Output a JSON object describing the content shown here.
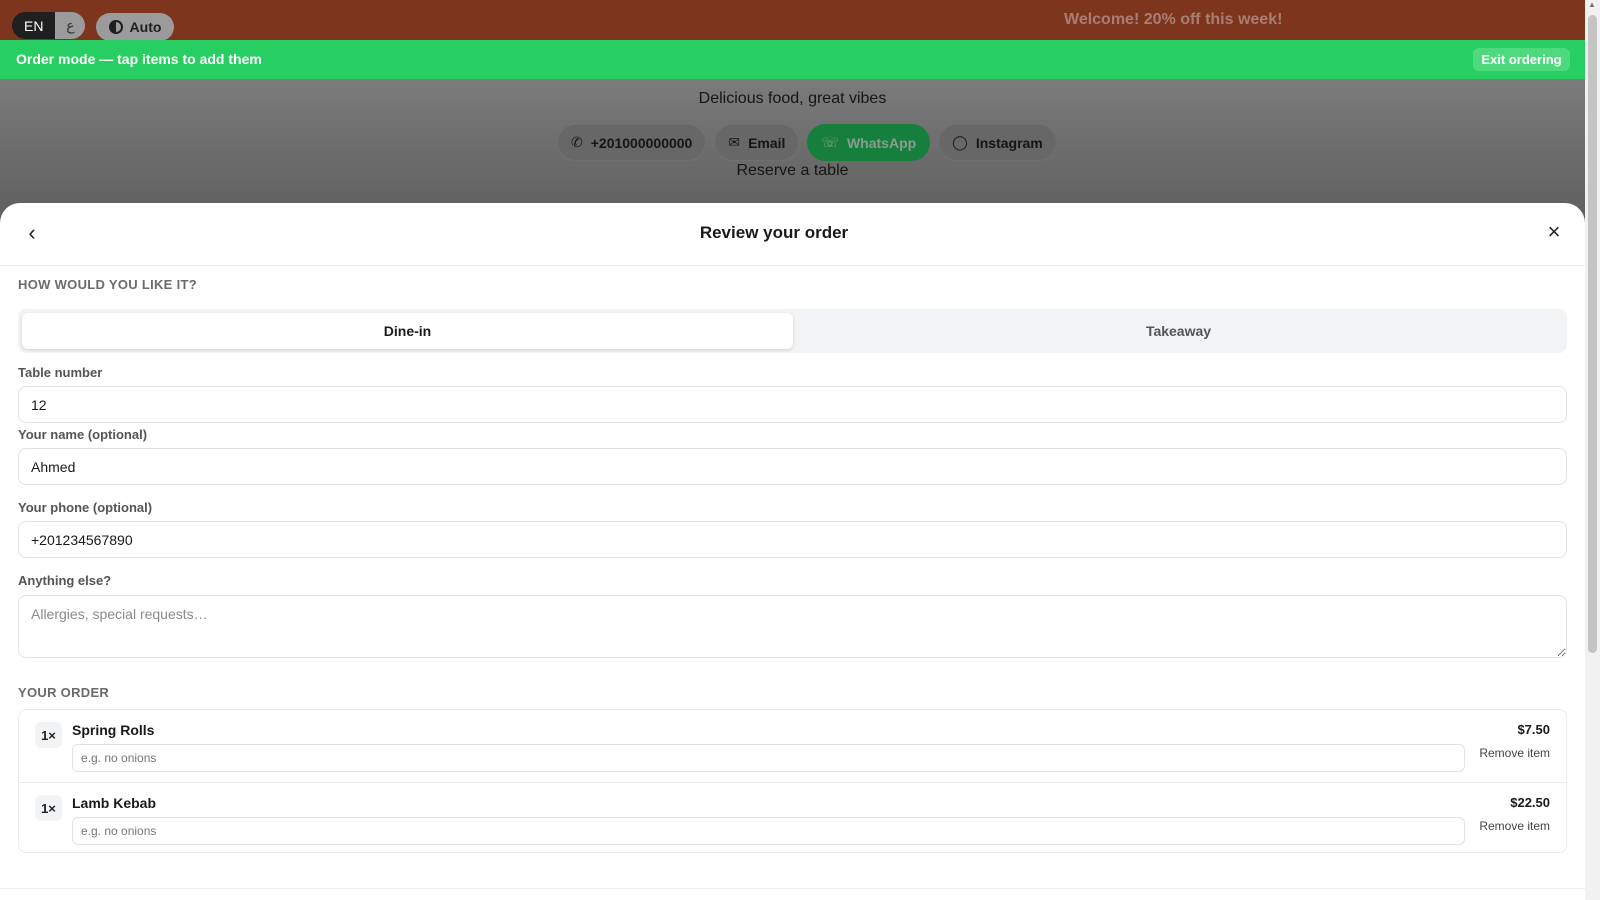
{
  "topbar": {
    "lang_active": "EN",
    "lang_other": "ع",
    "theme_label": "Auto",
    "promo": "Welcome! 20% off this week!"
  },
  "orderbar": {
    "text": "Order mode — tap items to add them",
    "exit_label": "Exit ordering"
  },
  "hero": {
    "tagline": "Delicious food, great vibes",
    "contacts": [
      {
        "icon": "phone-icon",
        "label": "+201000000000"
      },
      {
        "icon": "email-icon",
        "label": "Email"
      },
      {
        "icon": "whatsapp-icon",
        "label": "WhatsApp"
      },
      {
        "icon": "instagram-icon",
        "label": "Instagram"
      }
    ],
    "reserve": "Reserve a table"
  },
  "sheet": {
    "title": "Review your order",
    "mode_section": "HOW WOULD YOU LIKE IT?",
    "modes": [
      {
        "label": "Dine-in",
        "selected": true
      },
      {
        "label": "Takeaway",
        "selected": false
      }
    ],
    "fields": {
      "table": {
        "label": "Table number",
        "value": "12"
      },
      "name": {
        "label": "Your name (optional)",
        "value": "Ahmed"
      },
      "phone": {
        "label": "Your phone (optional)",
        "value": "+201234567890"
      },
      "notes": {
        "label": "Anything else?",
        "placeholder": "Allergies, special requests…"
      }
    },
    "order_section": "YOUR ORDER",
    "items": [
      {
        "qty": "1×",
        "name": "Spring Rolls",
        "price": "$7.50",
        "note_placeholder": "e.g. no onions",
        "remove": "Remove item"
      },
      {
        "qty": "1×",
        "name": "Lamb Kebab",
        "price": "$22.50",
        "note_placeholder": "e.g. no onions",
        "remove": "Remove item"
      }
    ]
  },
  "colors": {
    "topbar": "#7e351d",
    "orderbar": "#27cf62",
    "whatsapp": "#167f3d"
  }
}
